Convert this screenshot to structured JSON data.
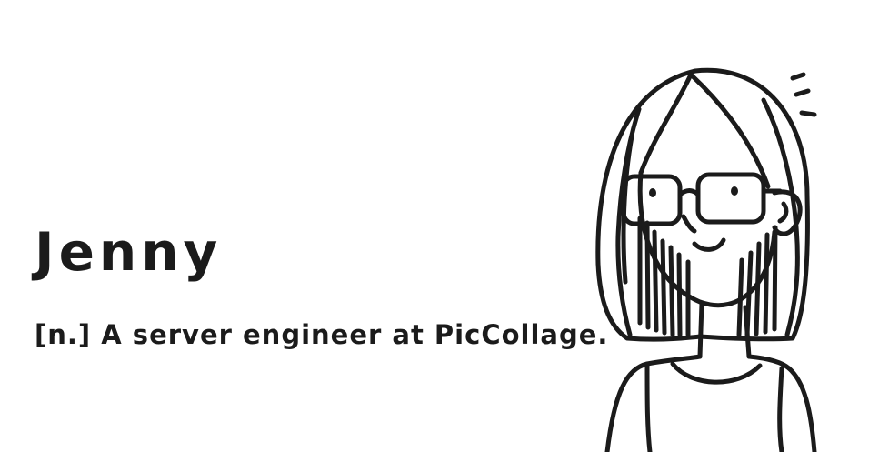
{
  "card": {
    "name": "Jenny",
    "definition": "[n.] A server engineer at PicCollage."
  },
  "portrait": {
    "icon": "woman-with-glasses-illustration",
    "ink_color": "#1b1b1b",
    "background": "#ffffff"
  }
}
